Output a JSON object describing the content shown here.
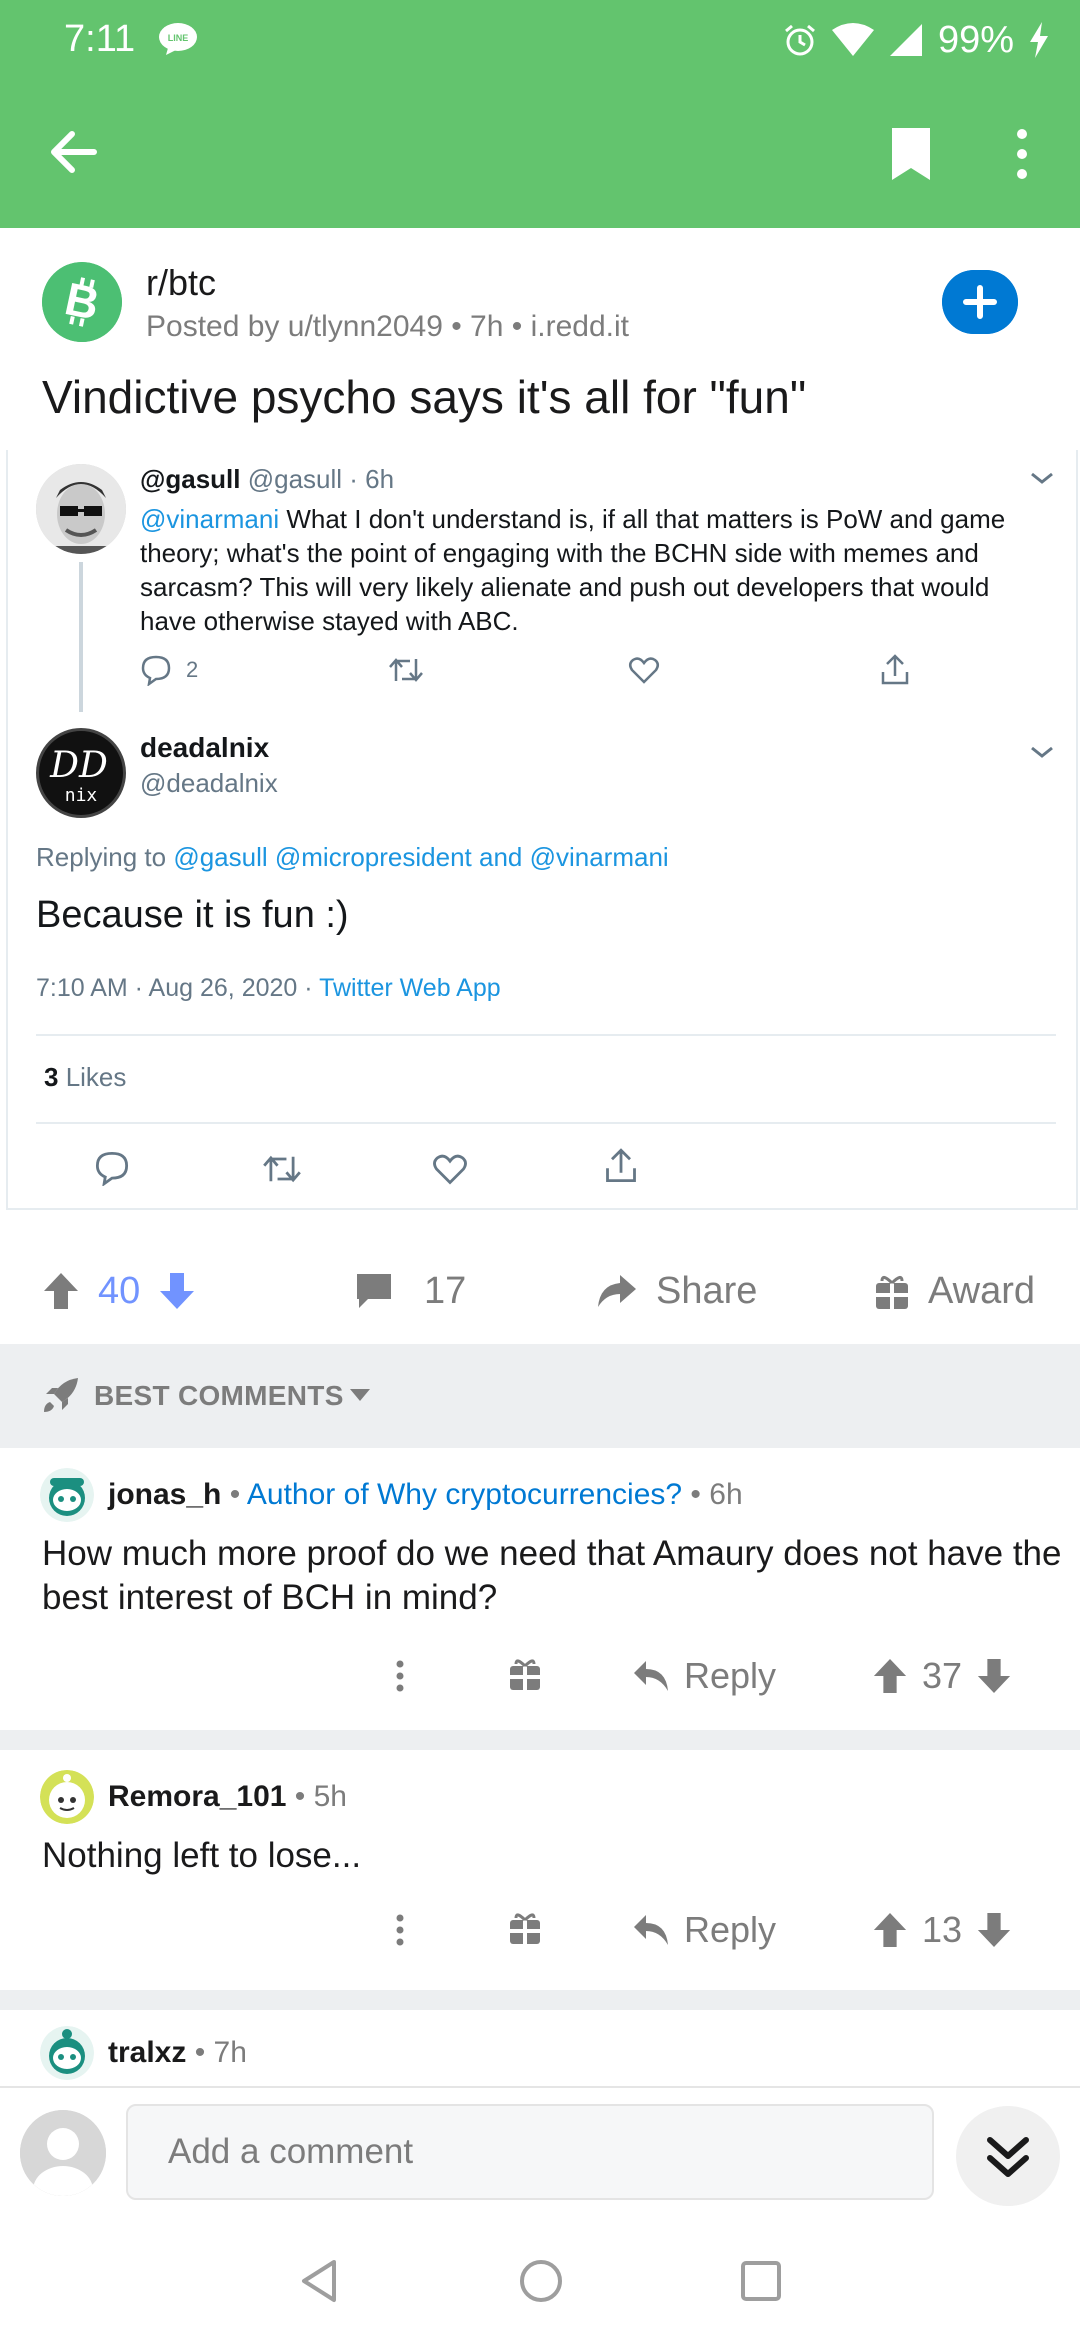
{
  "status_bar": {
    "time": "7:11",
    "battery": "99%"
  },
  "app_bar": {
    "back_icon": "arrow-left-icon",
    "bookmark_icon": "bookmark-icon",
    "more_icon": "more-vert-icon"
  },
  "post": {
    "subreddit": "r/btc",
    "meta": "Posted by u/tlynn2049 • 7h • i.redd.it",
    "title": "Vindictive psycho says it's all for \"fun\"",
    "upvotes": "40",
    "comments": "17",
    "share_label": "Share",
    "award_label": "Award"
  },
  "tweet": {
    "first": {
      "name": "@gasull",
      "handle_time": "@gasull · 6h",
      "mention": "@vinarmani",
      "text": " What I don't understand is, if all that matters is PoW and game theory; what's the point of engaging with the BCHN side with memes and sarcasm?  This will very likely alienate and push out developers that would have otherwise stayed with ABC.",
      "reply_count": "2"
    },
    "second": {
      "name": "deadalnix",
      "handle": "@deadalnix",
      "replying_prefix": "Replying to ",
      "replying_to": "@gasull @micropresident and @vinarmani",
      "text": "Because it is fun :)",
      "datetime": "7:10 AM · Aug 26, 2020 · ",
      "source": "Twitter Web App",
      "likes_count": "3",
      "likes_label": " Likes"
    }
  },
  "sort": {
    "label": "BEST COMMENTS"
  },
  "comments": [
    {
      "author": "jonas_h",
      "flair": "Author of Why cryptocurrencies?",
      "time": " • 6h",
      "text": "How much more proof do we need that Amaury does not have the best interest of BCH in mind?",
      "reply_label": "Reply",
      "score": "37"
    },
    {
      "author": "Remora_101",
      "flair": "",
      "time": " • 5h",
      "text": "Nothing left to lose...",
      "reply_label": "Reply",
      "score": "13"
    },
    {
      "author": "tralxz",
      "flair": "",
      "time": " • 7h",
      "text": "",
      "reply_label": "",
      "score": ""
    }
  ],
  "comment_bar": {
    "placeholder": "Add a comment"
  },
  "colors": {
    "app_bar": "#63c46e",
    "upvote_active": "#7193ff",
    "link": "#0079d3",
    "twitter_link": "#1b95e0"
  }
}
